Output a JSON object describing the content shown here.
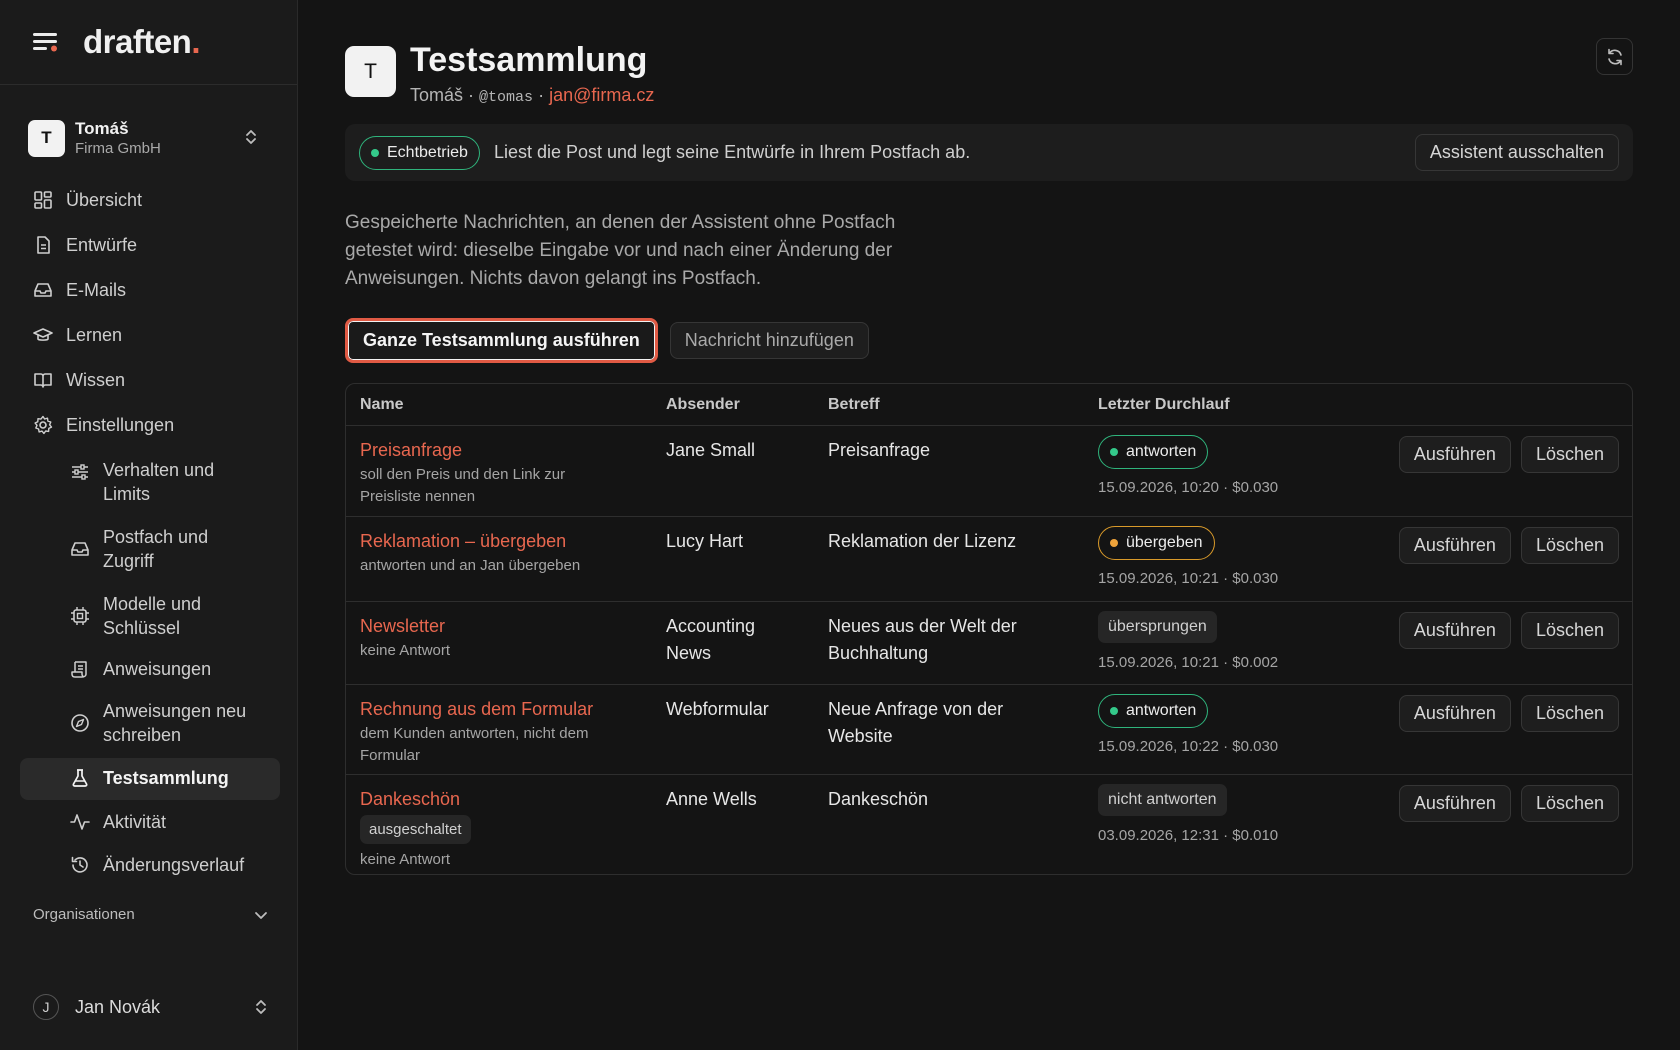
{
  "brand": {
    "logo_text": "draften",
    "logo_dot": ".",
    "accent": "#e8674f"
  },
  "account": {
    "initial": "T",
    "name": "Tomáš",
    "company": "Firma GmbH"
  },
  "nav": {
    "overview": "Übersicht",
    "drafts": "Entwürfe",
    "emails": "E-Mails",
    "learn": "Lernen",
    "knowledge": "Wissen",
    "settings": "Einstellungen",
    "behavior": "Verhalten und Limits",
    "mailbox": "Postfach und Zugriff",
    "models": "Modelle und Schlüssel",
    "instructions": "Anweisungen",
    "rewrite": "Anweisungen neu schreiben",
    "testsuite": "Testsammlung",
    "activity": "Aktivität",
    "history": "Änderungsverlauf"
  },
  "org_label": "Organisationen",
  "user": {
    "initial": "J",
    "name": "Jan Novák"
  },
  "header": {
    "initial": "T",
    "title": "Testsammlung",
    "owner": "Tomáš",
    "sep": "·",
    "handle": "@tomas",
    "email": "jan@firma.cz"
  },
  "banner": {
    "mode": "Echtbetrieb",
    "text": "Liest die Post und legt seine Entwürfe in Ihrem Postfach ab.",
    "disable_button": "Assistent ausschalten"
  },
  "description": "Gespeicherte Nachrichten, an denen der Assistent ohne Postfach getestet wird: dieselbe Eingabe vor und nach einer Änderung der Anweisungen. Nichts davon gelangt ins Postfach.",
  "actions": {
    "run_all": "Ganze Testsammlung ausführen",
    "add_message": "Nachricht hinzufügen"
  },
  "table": {
    "columns": {
      "name": "Name",
      "sender": "Absender",
      "subject": "Betreff",
      "last_run": "Letzter Durchlauf"
    },
    "run_label": "Ausführen",
    "delete_label": "Löschen",
    "rows": [
      {
        "name": "Preisanfrage",
        "note": "soll den Preis und den Link zur Preisliste nennen",
        "sender": "Jane Small",
        "subject": "Preisanfrage",
        "status": "antworten",
        "meta": "15.09.2026, 10:20 · $0.030"
      },
      {
        "name": "Reklamation – übergeben",
        "note": "antworten und an Jan übergeben",
        "sender": "Lucy Hart",
        "subject": "Reklamation der Lizenz",
        "status": "übergeben",
        "meta": "15.09.2026, 10:21 · $0.030"
      },
      {
        "name": "Newsletter",
        "note": "keine Antwort",
        "sender": "Accounting News",
        "subject": "Neues aus der Welt der Buchhaltung",
        "status": "übersprungen",
        "meta": "15.09.2026, 10:21 · $0.002"
      },
      {
        "name": "Rechnung aus dem Formular",
        "note": "dem Kunden antworten, nicht dem Formular",
        "sender": "Webformular",
        "subject": "Neue Anfrage von der Website",
        "status": "antworten",
        "meta": "15.09.2026, 10:22 · $0.030"
      },
      {
        "name": "Dankeschön",
        "tag": "ausgeschaltet",
        "note": "keine Antwort",
        "sender": "Anne Wells",
        "subject": "Dankeschön",
        "status": "nicht antworten",
        "meta": "03.09.2026, 12:31 · $0.010"
      }
    ]
  },
  "colors": {
    "status_green": "#34c98a",
    "status_orange": "#f0a43b",
    "focus_ring": "#e05a44"
  }
}
